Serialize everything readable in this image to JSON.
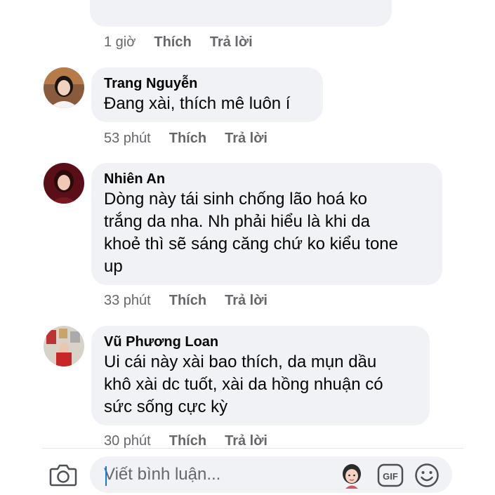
{
  "comments": [
    {
      "author": "",
      "text": "",
      "time": "1 giờ",
      "like_label": "Thích",
      "reply_label": "Trả lời"
    },
    {
      "author": "Trang Nguyễn",
      "lines": [
        "Đang xài, thích mê luôn í"
      ],
      "time": "53 phút",
      "like_label": "Thích",
      "reply_label": "Trả lời"
    },
    {
      "author": "Nhiên An",
      "lines": [
        "Dòng này tái sinh chống lão hoá ko",
        "trắng da nha. Nh phải hiểu là khi da",
        "khoẻ thì sẽ sáng căng chứ ko kiểu tone",
        "up"
      ],
      "time": "33 phút",
      "like_label": "Thích",
      "reply_label": "Trả lời"
    },
    {
      "author": "Vũ Phương Loan",
      "lines": [
        "Ui cái này xài bao thích, da mụn dầu",
        "khô xài dc tuốt, xài da hồng nhuận có",
        "sức sống cực kỳ"
      ],
      "time": "30 phút",
      "like_label": "Thích",
      "reply_label": "Trả lời"
    }
  ],
  "composer": {
    "placeholder": "Viết bình luận...",
    "gif_label": "GIF",
    "icons": [
      "camera-icon",
      "avatar-sticker-icon",
      "gif-icon",
      "emoji-icon"
    ]
  },
  "colors": {
    "bubble": "#f0f2f5",
    "meta": "#65676b",
    "text": "#050505",
    "caret": "#1b74e4"
  }
}
